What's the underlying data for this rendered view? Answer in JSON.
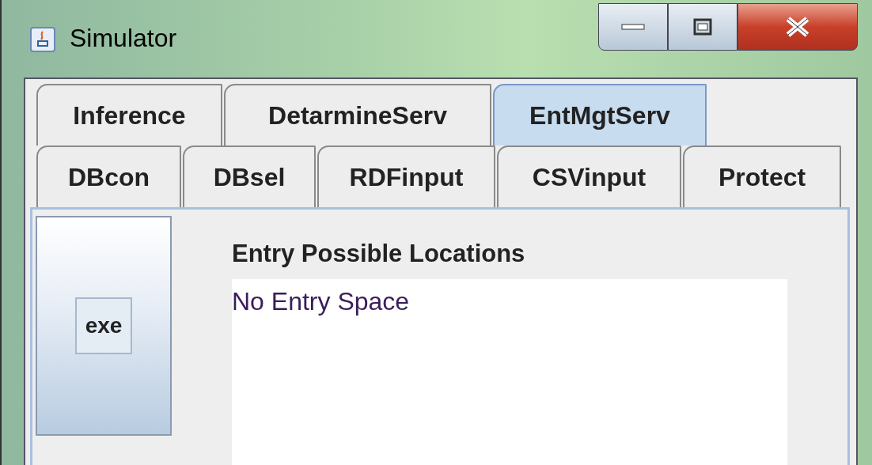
{
  "window": {
    "title": "Simulator"
  },
  "tab_rows": [
    [
      {
        "label": "Inference",
        "selected": false
      },
      {
        "label": "DetarmineServ",
        "selected": false
      },
      {
        "label": "EntMgtServ",
        "selected": true
      }
    ],
    [
      {
        "label": "DBcon",
        "selected": false
      },
      {
        "label": "DBsel",
        "selected": false
      },
      {
        "label": "RDFinput",
        "selected": false
      },
      {
        "label": "CSVinput",
        "selected": false
      },
      {
        "label": "Protect",
        "selected": false
      }
    ]
  ],
  "panel": {
    "button": "exe",
    "list_label": "Entry Possible Locations",
    "list_items": [
      "No Entry Space"
    ]
  }
}
